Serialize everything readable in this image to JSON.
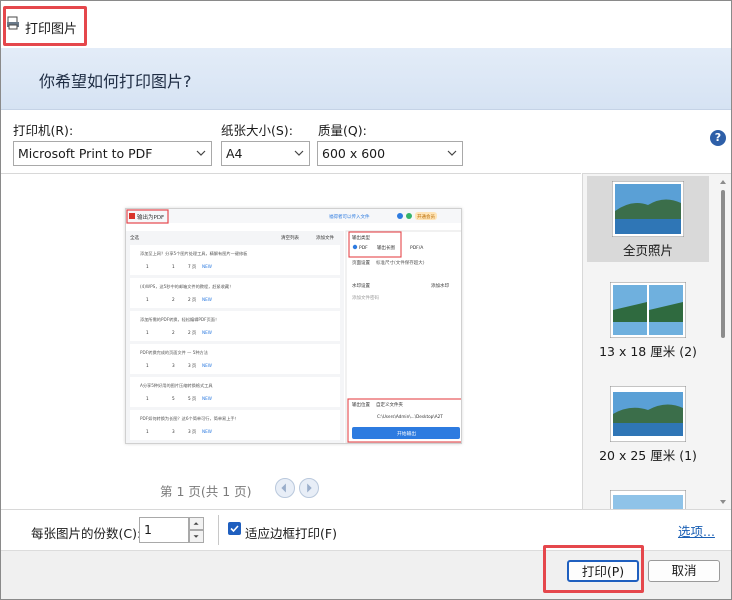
{
  "window": {
    "title": "打印图片"
  },
  "header": {
    "title": "你希望如何打印图片?"
  },
  "options": {
    "printer_label": "打印机(R):",
    "printer_value": "Microsoft Print to PDF",
    "paper_label": "纸张大小(S):",
    "paper_value": "A4",
    "quality_label": "质量(Q):",
    "quality_value": "600 x 600"
  },
  "preview": {
    "pager_text": "第 1 页(共 1 页)",
    "thumb": {
      "app_title": "输出为PDF",
      "top_badge": "开通会员",
      "top_link": "福得者可以传入文件",
      "all_label": "全选",
      "clear_list": "清空列表",
      "add_file": "添加文件",
      "list_rows": [
        {
          "text": "添加至上网？分享5个图片处理工具，精解有图片一键修板",
          "p1": "1",
          "p2": "1",
          "pages": "7 页",
          "tag": "NEW"
        },
        {
          "text": "(4)WPS，这5秒中的邮箱文件的教程，赶紧收藏！",
          "p1": "1",
          "p2": "2",
          "pages": "2 页",
          "tag": "NEW"
        },
        {
          "text": "添加所需的PDF转换，轻松编辑PDF页面！",
          "p1": "1",
          "p2": "2",
          "pages": "2 页",
          "tag": "NEW"
        },
        {
          "text": "PDF转换完成的页面文件 — 5种方法",
          "p1": "1",
          "p2": "3",
          "pages": "3 页",
          "tag": "NEW"
        },
        {
          "text": "A分享5种好用的图片压缩转换格式工具",
          "p1": "1",
          "p2": "5",
          "pages": "5 页",
          "tag": "NEW"
        },
        {
          "text": "PDF如何转换为长图？这6个简单可行，简单易上手！",
          "p1": "1",
          "p2": "3",
          "pages": "3 页",
          "tag": "NEW"
        }
      ],
      "output_type_label": "输出类型",
      "radio_pdf": "PDF",
      "radio_image": "输出长图",
      "radio_pdfa": "PDF/A",
      "page_setting_label": "页面设置",
      "page_setting_value": "标准尺寸(文件保存超大)",
      "watermark_label": "水印设置",
      "watermark_value": "添加水印",
      "encrypt_label": "添加文件密码",
      "output_dir_label": "输出位置",
      "output_dir_value": "自定义文件夹",
      "output_path": "C:\\Users\\Admin\\...\\Desktop\\A2T",
      "start_button": "开始输出"
    }
  },
  "layouts": [
    {
      "label": "全页照片",
      "selected": true
    },
    {
      "label": "13 x 18 厘米 (2)",
      "selected": false
    },
    {
      "label": "20 x 25 厘米 (1)",
      "selected": false
    },
    {
      "label": "",
      "selected": false
    }
  ],
  "bottom": {
    "copies_label": "每张图片的份数(C):",
    "copies_value": "1",
    "fit_label": "适应边框打印(F)",
    "fit_checked": true,
    "options_link": "选项..."
  },
  "buttons": {
    "print": "打印(P)",
    "cancel": "取消"
  },
  "colors": {
    "accent": "#1f5fbf",
    "highlight": "#e5474c",
    "header_band": "#dce7f5"
  }
}
